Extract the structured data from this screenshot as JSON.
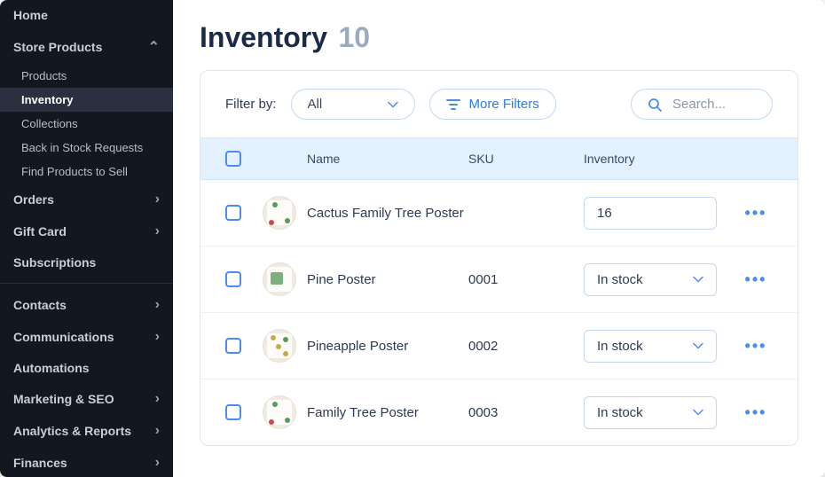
{
  "sidebar": {
    "items": [
      {
        "label": "Home",
        "type": "item",
        "expand": null
      },
      {
        "label": "Store Products",
        "type": "item",
        "expand": "up"
      },
      {
        "label": "Products",
        "type": "sub"
      },
      {
        "label": "Inventory",
        "type": "sub",
        "active": true
      },
      {
        "label": "Collections",
        "type": "sub"
      },
      {
        "label": "Back in Stock Requests",
        "type": "sub"
      },
      {
        "label": "Find Products to Sell",
        "type": "sub"
      },
      {
        "label": "Orders",
        "type": "item",
        "expand": "right"
      },
      {
        "label": "Gift Card",
        "type": "item",
        "expand": "right"
      },
      {
        "label": "Subscriptions",
        "type": "item",
        "expand": null
      },
      {
        "label": "Contacts",
        "type": "item",
        "expand": "right"
      },
      {
        "label": "Communications",
        "type": "item",
        "expand": "right"
      },
      {
        "label": "Automations",
        "type": "item",
        "expand": null
      },
      {
        "label": "Marketing & SEO",
        "type": "item",
        "expand": "right"
      },
      {
        "label": "Analytics & Reports",
        "type": "item",
        "expand": "right"
      },
      {
        "label": "Finances",
        "type": "item",
        "expand": "right"
      }
    ]
  },
  "page": {
    "title": "Inventory",
    "count": "10"
  },
  "filter": {
    "label": "Filter by:",
    "select_value": "All",
    "more_filters": "More Filters",
    "search_placeholder": "Search..."
  },
  "table": {
    "headers": {
      "name": "Name",
      "sku": "SKU",
      "inventory": "Inventory"
    },
    "rows": [
      {
        "name": "Cactus Family Tree Poster",
        "sku": "",
        "inventory": "16",
        "inv_type": "text"
      },
      {
        "name": "Pine Poster",
        "sku": "0001",
        "inventory": "In stock",
        "inv_type": "select"
      },
      {
        "name": "Pineapple Poster",
        "sku": "0002",
        "inventory": "In stock",
        "inv_type": "select"
      },
      {
        "name": "Family Tree Poster",
        "sku": "0003",
        "inventory": "In stock",
        "inv_type": "select"
      }
    ]
  }
}
